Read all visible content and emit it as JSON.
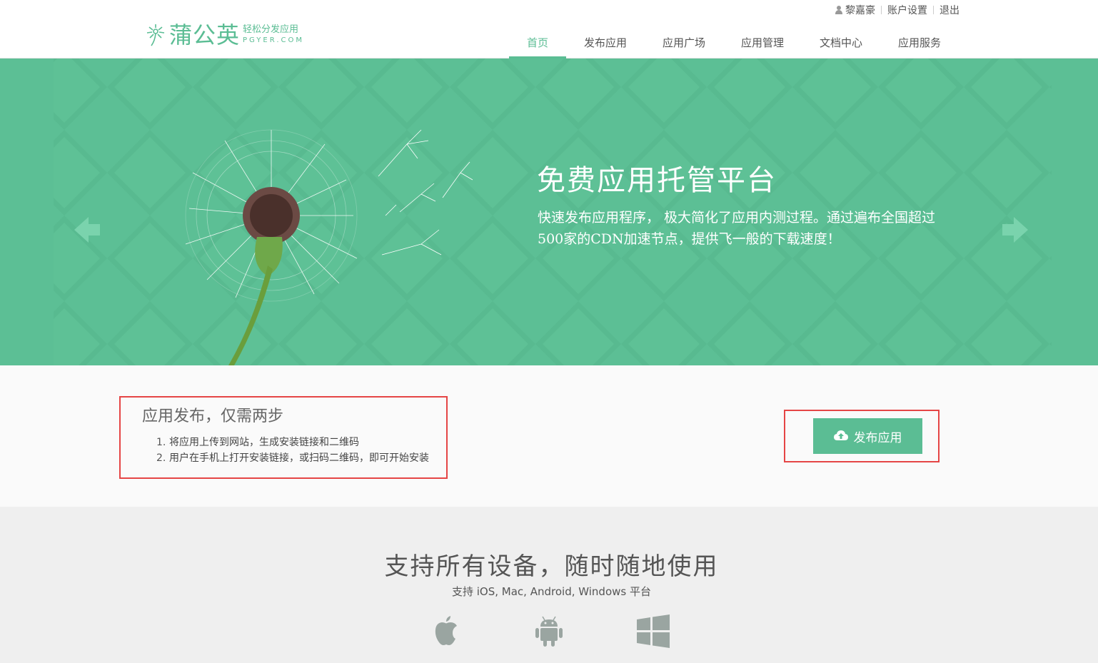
{
  "userbar": {
    "username": "黎嘉豪",
    "account_settings": "账户设置",
    "logout": "退出"
  },
  "logo": {
    "name": "蒲公英",
    "slogan": "轻松分发应用",
    "domain": "PGYER.COM"
  },
  "nav": {
    "items": [
      {
        "label": "首页",
        "active": true
      },
      {
        "label": "发布应用",
        "active": false
      },
      {
        "label": "应用广场",
        "active": false
      },
      {
        "label": "应用管理",
        "active": false
      },
      {
        "label": "文档中心",
        "active": false
      },
      {
        "label": "应用服务",
        "active": false
      }
    ]
  },
  "hero": {
    "title": "免费应用托管平台",
    "description": "快速发布应用程序， 极大简化了应用内测过程。通过遍布全国超过500家的CDN加速节点，提供飞一般的下载速度！",
    "prev_icon": "arrow-left-icon",
    "next_icon": "arrow-right-icon"
  },
  "publish": {
    "title": "应用发布，仅需两步",
    "steps": [
      {
        "num": "1.",
        "text": "将应用上传到网站，生成安装链接和二维码"
      },
      {
        "num": "2.",
        "text": "用户在手机上打开安装链接，或扫码二维码，即可开始安装"
      }
    ],
    "button_label": "发布应用",
    "button_icon": "cloud-upload-icon"
  },
  "devices": {
    "title": "支持所有设备，随时随地使用",
    "subtitle": "支持 iOS, Mac, Android, Windows 平台",
    "icons": [
      "apple-icon",
      "android-icon",
      "windows-icon"
    ]
  },
  "colors": {
    "brand": "#5bbd94",
    "hero_bg": "#5cbf95",
    "highlight_border": "#e54545",
    "icon_gray": "#9aa5a1"
  }
}
